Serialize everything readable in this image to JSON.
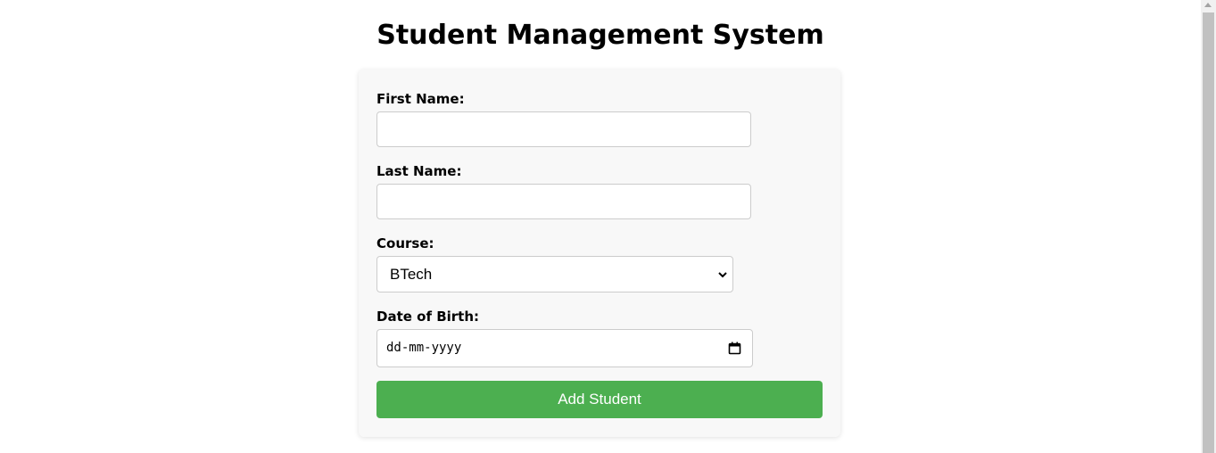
{
  "page": {
    "title": "Student Management System"
  },
  "form": {
    "first_name": {
      "label": "First Name:",
      "value": ""
    },
    "last_name": {
      "label": "Last Name:",
      "value": ""
    },
    "course": {
      "label": "Course:",
      "selected": "BTech"
    },
    "dob": {
      "label": "Date of Birth:",
      "placeholder": "dd-mm-yyyy"
    },
    "submit_label": "Add Student"
  },
  "colors": {
    "accent": "#4caf50",
    "card_background": "#f8f8f8"
  }
}
